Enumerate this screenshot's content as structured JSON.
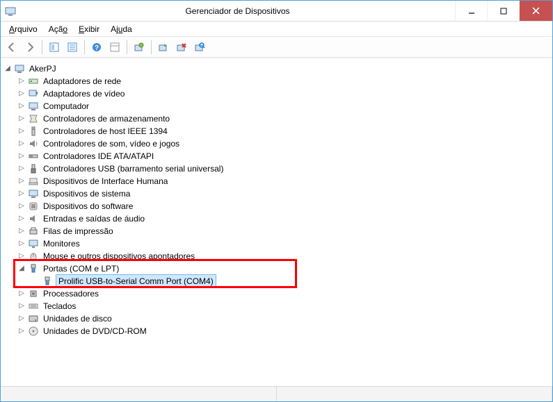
{
  "window": {
    "title": "Gerenciador de Dispositivos"
  },
  "menu": {
    "arquivo": "Arquivo",
    "acao": "Ação",
    "exibir": "Exibir",
    "ajuda": "Ajuda"
  },
  "tree": {
    "root": "AkerPJ",
    "nodes": {
      "adaptadores_rede": "Adaptadores de rede",
      "adaptadores_video": "Adaptadores de vídeo",
      "computador": "Computador",
      "controladores_armazenamento": "Controladores de armazenamento",
      "controladores_host_1394": "Controladores de host IEEE 1394",
      "controladores_som": "Controladores de som, vídeo e jogos",
      "controladores_ide": "Controladores IDE ATA/ATAPI",
      "controladores_usb": "Controladores USB (barramento serial universal)",
      "dispositivos_interface_humana": "Dispositivos de Interface Humana",
      "dispositivos_sistema": "Dispositivos de sistema",
      "dispositivos_software": "Dispositivos do software",
      "entradas_saidas_audio": "Entradas e saídas de áudio",
      "filas_impressao": "Filas de impressão",
      "monitores": "Monitores",
      "mouse": "Mouse e outros dispositivos apontadores",
      "portas": "Portas (COM e LPT)",
      "portas_child": "Prolific USB-to-Serial Comm Port (COM4)",
      "processadores": "Processadores",
      "teclados": "Teclados",
      "unidades_disco": "Unidades de disco",
      "unidades_dvd": "Unidades de DVD/CD-ROM"
    }
  }
}
